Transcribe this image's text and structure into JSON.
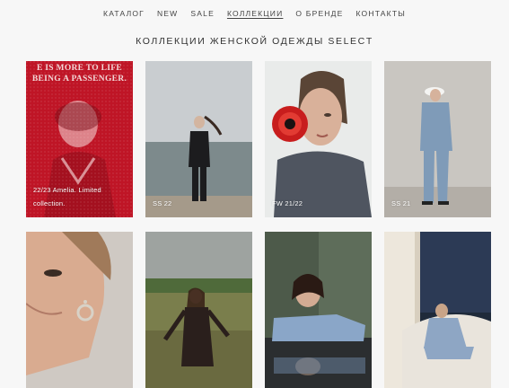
{
  "nav": {
    "items": [
      {
        "label": "КАТАЛОГ"
      },
      {
        "label": "NEW"
      },
      {
        "label": "SALE"
      },
      {
        "label": "КОЛЛЕКЦИИ",
        "active": true
      },
      {
        "label": "О БРЕНДЕ"
      },
      {
        "label": "КОНТАКТЫ"
      }
    ]
  },
  "page": {
    "title": "КОЛЛЕКЦИИ ЖЕНСКОЙ ОДЕЖДЫ SELECT"
  },
  "collections": [
    {
      "caption_line1": "22/23 Amelia. Limited",
      "caption_line2": "collection.",
      "cover_text_line1": "E IS MORE TO LIFE",
      "cover_text_line2": "BEING A PASSENGER."
    },
    {
      "caption": "SS 22"
    },
    {
      "caption": "FW 21/22"
    },
    {
      "caption": "SS 21"
    },
    {
      "caption": ""
    },
    {
      "caption": ""
    },
    {
      "caption": ""
    },
    {
      "caption": ""
    }
  ],
  "colors": {
    "background": "#f7f7f7",
    "text": "#333333",
    "accent_red": "#c8182a"
  }
}
